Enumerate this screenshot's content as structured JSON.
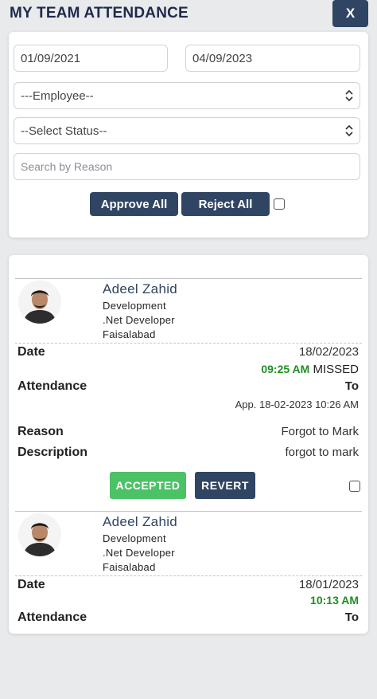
{
  "header": {
    "title": "MY TEAM ATTENDANCE",
    "close_label": "X"
  },
  "filters": {
    "date_from": "01/09/2021",
    "date_to": "04/09/2023",
    "employee_select": "---Employee--",
    "status_select": "--Select Status--",
    "search_placeholder": "Search by Reason",
    "approve_all_label": "Approve All",
    "reject_all_label": "Reject All"
  },
  "labels": {
    "date": "Date",
    "attendance": "Attendance",
    "reason": "Reason",
    "description": "Description",
    "to": "To"
  },
  "entries": [
    {
      "name": "Adeel Zahid",
      "department": "Development",
      "designation": ".Net Developer",
      "city": "Faisalabad",
      "date": "18/02/2023",
      "time": "09:25 AM",
      "status": "MISSED",
      "approved_info": "App. 18-02-2023 10:26 AM",
      "reason": "Forgot to Mark",
      "description": "forgot to mark",
      "accepted_label": "ACCEPTED",
      "revert_label": "REVERT"
    },
    {
      "name": "Adeel Zahid",
      "department": "Development",
      "designation": ".Net Developer",
      "city": "Faisalabad",
      "date": "18/01/2023",
      "time": "10:13 AM"
    }
  ],
  "colors": {
    "primary": "#2f4563",
    "accepted": "#4cc267",
    "time_green": "#1f8f1f"
  }
}
